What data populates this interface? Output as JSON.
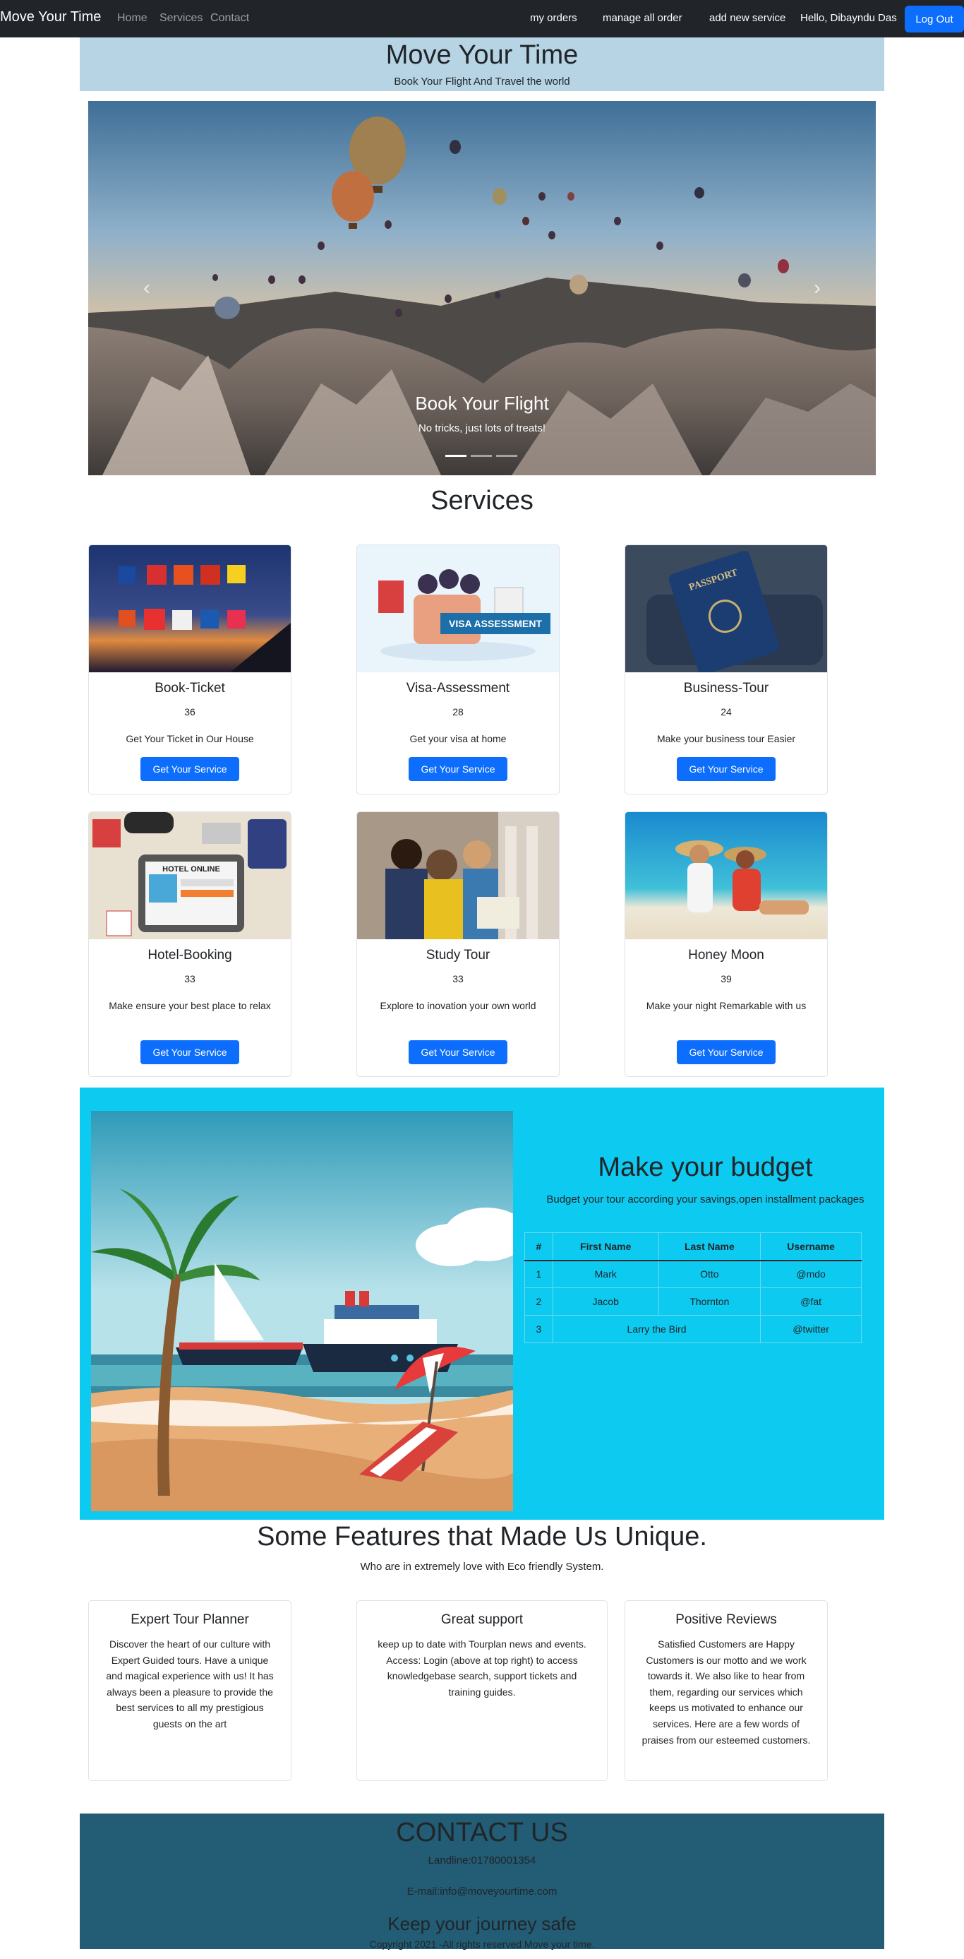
{
  "navbar": {
    "brand": "Move Your Time",
    "links": [
      "Home",
      "Services",
      "Contact"
    ],
    "right_links": [
      "my orders",
      "manage all order",
      "add new service"
    ],
    "greeting": "Hello, Dibayndu Das",
    "logout_label": "Log Out",
    "logout_color": "#0d6efd"
  },
  "header": {
    "title": "Move Your Time",
    "subtitle": "Book Your Flight And Travel the world"
  },
  "carousel": {
    "caption_title": "Book Your Flight",
    "caption_text": "No tricks, just lots of treats!",
    "prev_icon": "chevron-left-icon",
    "next_icon": "chevron-right-icon",
    "slide_count": 3,
    "active_slide": 1
  },
  "services": {
    "title": "Services",
    "button_label": "Get Your Service",
    "items": [
      {
        "title": "Book-Ticket",
        "count": "36",
        "desc": "Get Your Ticket in Our House"
      },
      {
        "title": "Visa-Assessment",
        "count": "28",
        "desc": "Get your visa at home",
        "image_text": "VISA ASSESSMENT"
      },
      {
        "title": "Business-Tour",
        "count": "24",
        "desc": "Make your business tour Easier",
        "image_text": "PASSPORT"
      },
      {
        "title": "Hotel-Booking",
        "count": "33",
        "desc": "Make ensure your best place to relax",
        "image_text": "HOTEL ONLINE"
      },
      {
        "title": "Study Tour",
        "count": "33",
        "desc": "Explore to inovation your own world"
      },
      {
        "title": "Honey Moon",
        "count": "39",
        "desc": "Make your night Remarkable with us"
      }
    ]
  },
  "budget": {
    "title": "Make your budget",
    "subtitle": "Budget your tour according your savings,open installment packages",
    "headers": [
      "#",
      "First Name",
      "Last Name",
      "Username"
    ],
    "rows": [
      [
        "1",
        "Mark",
        "Otto",
        "@mdo"
      ],
      [
        "2",
        "Jacob",
        "Thornton",
        "@fat"
      ],
      [
        "3",
        "Larry the Bird",
        "@twitter"
      ]
    ],
    "bg_color": "#0dcaf0"
  },
  "features": {
    "title": "Some Features that Made Us Unique.",
    "subtitle": "Who are in extremely love with Eco friendly System.",
    "items": [
      {
        "title": "Expert Tour Planner",
        "text": "Discover the heart of our culture with Expert Guided tours. Have a unique and magical experience with us! It has always been a pleasure to provide the best services to all my prestigious guests on the art"
      },
      {
        "title": "Great support",
        "text": "keep up to date with Tourplan news and events. Access: Login (above at top right) to access knowledgebase search, support tickets and training guides."
      },
      {
        "title": "Positive Reviews",
        "text": "Satisfied Customers are Happy Customers is our motto and we work towards it. We also like to hear from them, regarding our services which keeps us motivated to enhance our services. Here are a few words of praises from our esteemed customers."
      }
    ]
  },
  "contact": {
    "title": "CONTACT US",
    "landline": "Landline:01780001354",
    "email": "E-mail:info@moveyourtime.com",
    "subtitle": "Keep your journey safe",
    "copyright": "Copyright 2021 -All rights reserved Move your time.",
    "bg_color": "#225c75"
  }
}
